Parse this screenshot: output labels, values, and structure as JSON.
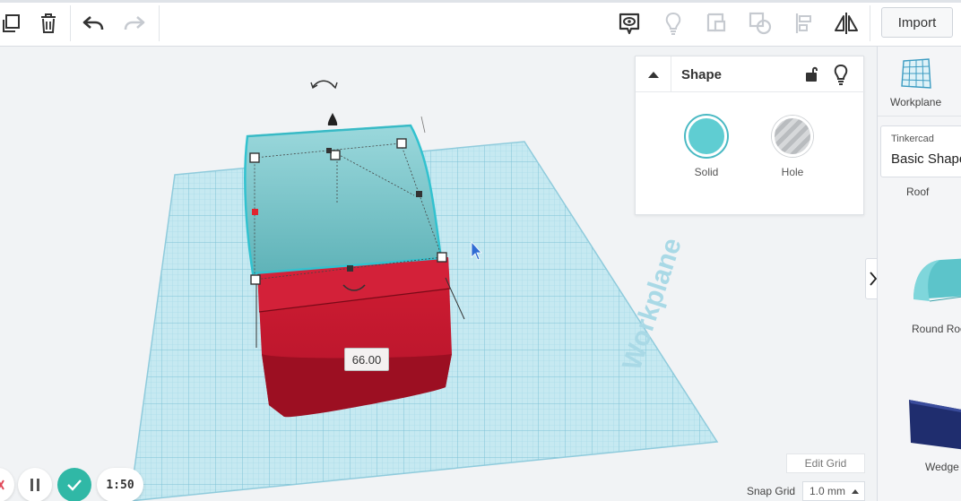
{
  "toolbar": {
    "import_label": "Import",
    "icons": [
      "copy-icon",
      "trash-icon",
      "undo-icon",
      "redo-icon",
      "notes-icon",
      "bulb-icon",
      "group-icon",
      "ungroup-icon",
      "align-icon",
      "mirror-icon"
    ]
  },
  "shape_panel": {
    "title": "Shape",
    "options": [
      {
        "label": "Solid",
        "selected": true,
        "color": "#5fcdd2"
      },
      {
        "label": "Hole",
        "selected": false
      }
    ]
  },
  "workplane": {
    "watermark": "Workplane",
    "dimension_value": "66.00",
    "grid_color": "#a8dcea",
    "top_color": "#77c9cf",
    "body_color": "#c0172b"
  },
  "right_panel": {
    "workplane_label": "Workplane",
    "library_small": "Tinkercad",
    "library_name": "Basic Shapes",
    "shapes": [
      "Roof",
      "Round Roof",
      "Wedge"
    ]
  },
  "grid_controls": {
    "edit_grid_label": "Edit Grid",
    "snap_label": "Snap Grid",
    "snap_value": "1.0 mm"
  },
  "playback": {
    "timer": "1:50"
  }
}
